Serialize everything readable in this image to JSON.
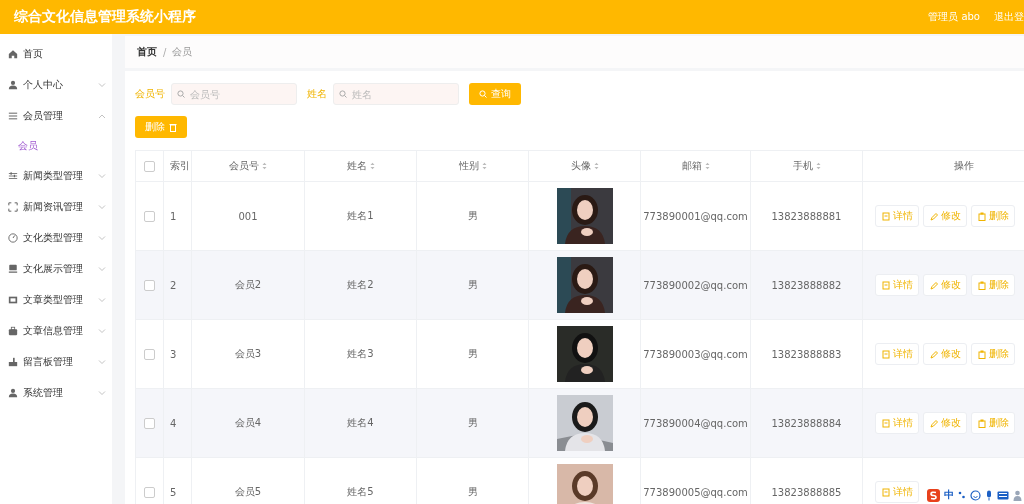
{
  "header": {
    "title": "综合文化信息管理系统小程序",
    "user": "管理员 abo",
    "logout": "退出登"
  },
  "sidebar": {
    "items": [
      {
        "label": "首页",
        "kind": "link"
      },
      {
        "label": "个人中心",
        "kind": "menu",
        "expanded": false
      },
      {
        "label": "会员管理",
        "kind": "menu",
        "expanded": true,
        "children": [
          {
            "label": "会员",
            "selected": true
          }
        ]
      },
      {
        "label": "新闻类型管理",
        "kind": "menu",
        "expanded": false
      },
      {
        "label": "新闻资讯管理",
        "kind": "menu",
        "expanded": false
      },
      {
        "label": "文化类型管理",
        "kind": "menu",
        "expanded": false
      },
      {
        "label": "文化展示管理",
        "kind": "menu",
        "expanded": false
      },
      {
        "label": "文章类型管理",
        "kind": "menu",
        "expanded": false
      },
      {
        "label": "文章信息管理",
        "kind": "menu",
        "expanded": false
      },
      {
        "label": "留言板管理",
        "kind": "menu",
        "expanded": false
      },
      {
        "label": "系统管理",
        "kind": "menu",
        "expanded": false
      }
    ]
  },
  "breadcrumb": [
    "首页",
    "会员"
  ],
  "breadcrumb_separator": "/",
  "search": {
    "fields": [
      {
        "label": "会员号",
        "placeholder": "会员号"
      },
      {
        "label": "姓名",
        "placeholder": "姓名"
      }
    ],
    "button": "查询"
  },
  "delete_button": "删除",
  "table": {
    "select_all": {
      "checked": false
    },
    "columns": [
      {
        "label": "索引",
        "sortable": false
      },
      {
        "label": "会员号",
        "sortable": true
      },
      {
        "label": "姓名",
        "sortable": true
      },
      {
        "label": "性别",
        "sortable": true
      },
      {
        "label": "头像",
        "sortable": true
      },
      {
        "label": "邮箱",
        "sortable": true
      },
      {
        "label": "手机",
        "sortable": true
      },
      {
        "label": "操作",
        "sortable": false
      }
    ],
    "rows": [
      {
        "checked": false,
        "index": "1",
        "id": "001",
        "name": "姓名1",
        "gender": "男",
        "avatar": {
          "kind": "picture"
        },
        "email": "773890001@qq.com",
        "phone": "13823888881",
        "actions": [
          "详情",
          "修改",
          "删除"
        ]
      },
      {
        "checked": false,
        "index": "2",
        "id": "会员2",
        "name": "姓名2",
        "gender": "男",
        "avatar": {
          "kind": "picture"
        },
        "email": "773890002@qq.com",
        "phone": "13823888882",
        "actions": [
          "详情",
          "修改",
          "删除"
        ]
      },
      {
        "checked": false,
        "index": "3",
        "id": "会员3",
        "name": "姓名3",
        "gender": "男",
        "avatar": {
          "kind": "picture"
        },
        "email": "773890003@qq.com",
        "phone": "13823888883",
        "actions": [
          "详情",
          "修改",
          "删除"
        ]
      },
      {
        "checked": false,
        "index": "4",
        "id": "会员4",
        "name": "姓名4",
        "gender": "男",
        "avatar": {
          "kind": "picture"
        },
        "email": "773890004@qq.com",
        "phone": "13823888884",
        "actions": [
          "详情",
          "修改",
          "删除"
        ]
      },
      {
        "checked": false,
        "index": "5",
        "id": "会员5",
        "name": "姓名5",
        "gender": "男",
        "avatar": {
          "kind": "picture"
        },
        "email": "773890005@qq.com",
        "phone": "13823888885",
        "actions": [
          "详情"
        ]
      }
    ]
  },
  "ime_toolbar": {
    "mode": "中"
  }
}
